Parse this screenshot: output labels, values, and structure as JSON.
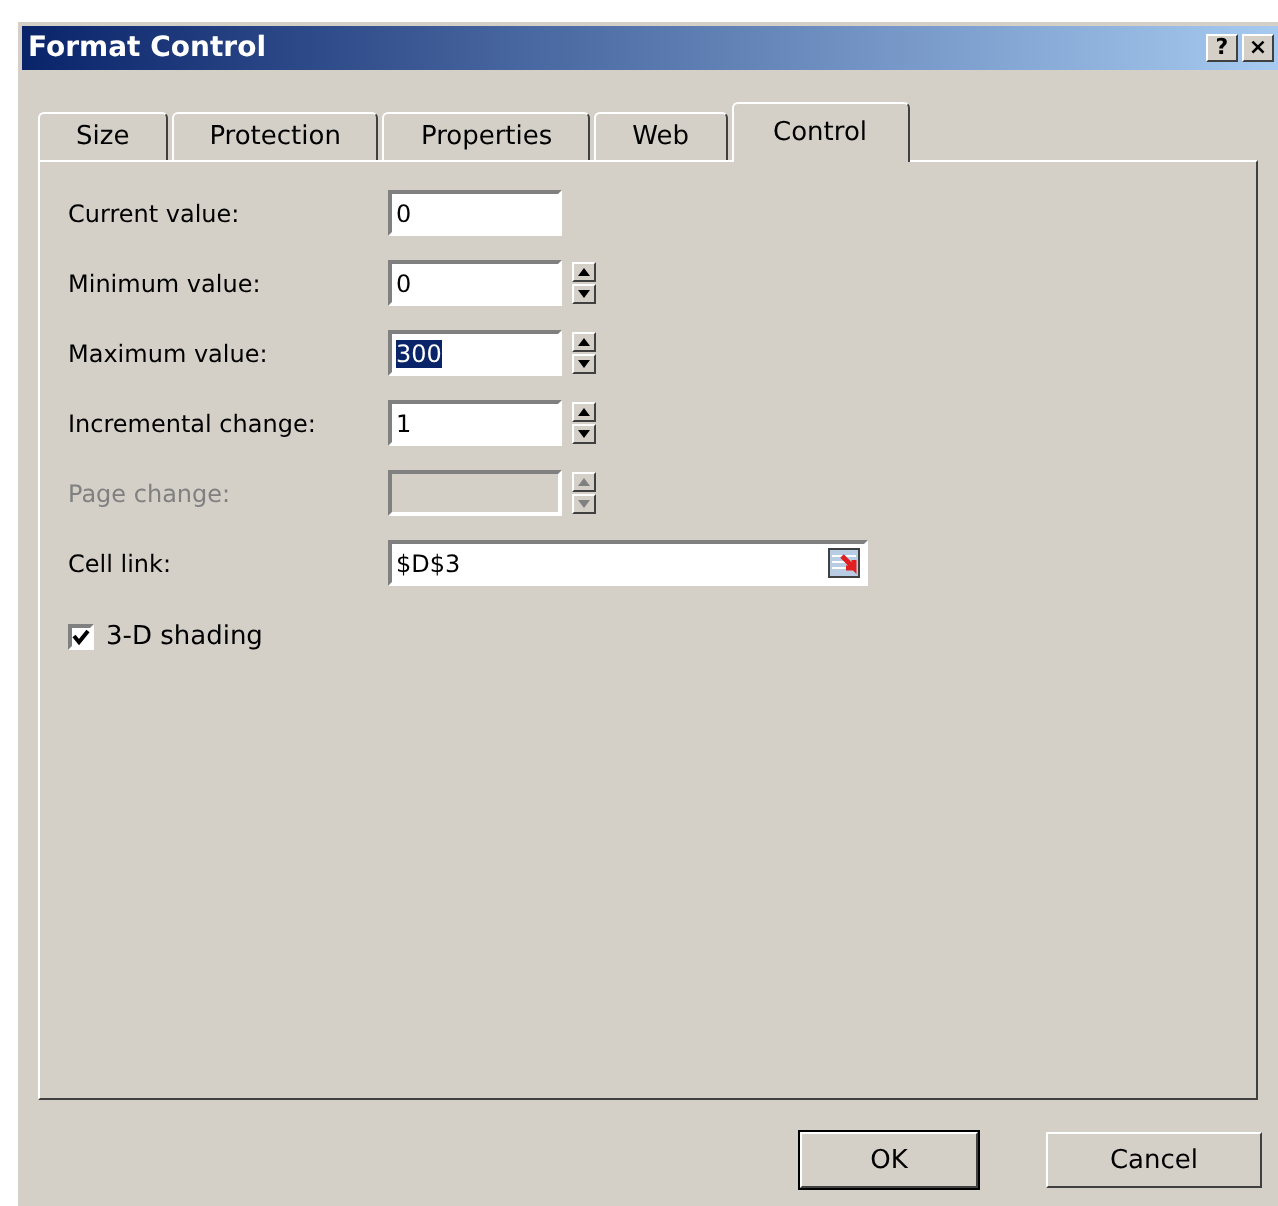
{
  "window": {
    "title": "Format Control",
    "help_button": "?",
    "close_button": "×"
  },
  "tabs": [
    {
      "label": "Size",
      "selected": false
    },
    {
      "label": "Protection",
      "selected": false
    },
    {
      "label": "Properties",
      "selected": false
    },
    {
      "label": "Web",
      "selected": false
    },
    {
      "label": "Control",
      "selected": true
    }
  ],
  "fields": [
    {
      "kind": "text",
      "label": "Current value:",
      "value": "0",
      "disabled": false
    },
    {
      "kind": "spin",
      "label": "Minimum value:",
      "value": "0",
      "disabled": false
    },
    {
      "kind": "spin",
      "label": "Maximum value:",
      "value": "300",
      "disabled": false,
      "highlighted": true
    },
    {
      "kind": "spin",
      "label": "Incremental change:",
      "value": "1",
      "disabled": false
    },
    {
      "kind": "spin",
      "label": "Page change:",
      "disabled": true
    },
    {
      "kind": "ref",
      "label": "Cell link:",
      "value": "$D$3",
      "disabled": false
    }
  ],
  "shading": {
    "label": "3-D shading",
    "checked": true
  },
  "buttons": [
    {
      "label": "OK",
      "default": true
    },
    {
      "label": "Cancel",
      "default": false
    }
  ]
}
